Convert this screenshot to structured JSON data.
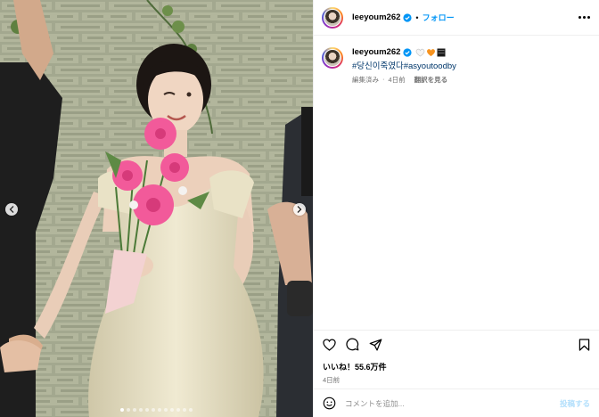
{
  "post": {
    "username": "leeyoum262",
    "follow_label": "フォロー",
    "separator": "•",
    "caption_emojis": [
      "white-heart",
      "orange-heart",
      "black-square"
    ],
    "hashtags": [
      "#당신이죽였다",
      "#asyoutoodby"
    ],
    "edited_label": "編集済み",
    "meta_sep": "·",
    "time_short": "4日前",
    "translate_label": "翻訳を見る",
    "likes_label": "いいね！55.6万件",
    "time_full": "4日前"
  },
  "comment": {
    "placeholder": "コメントを追加...",
    "post_label": "投稿する"
  },
  "carousel": {
    "total": 12,
    "active_index": 0
  },
  "colors": {
    "accent": "#0095f6",
    "hashtag": "#00376b",
    "muted": "#737373",
    "post_disabled": "#b2dffc"
  },
  "icons": {
    "verified": "verified-badge-icon",
    "more": "more-options-icon",
    "like": "heart-icon",
    "comment": "comment-icon",
    "share": "share-icon",
    "bookmark": "bookmark-icon",
    "emoji": "emoji-icon"
  }
}
